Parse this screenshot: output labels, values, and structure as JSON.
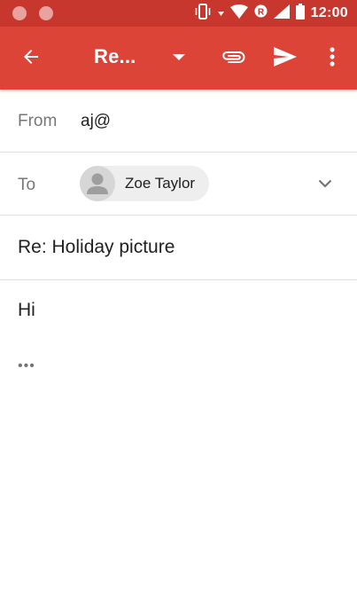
{
  "status_bar": {
    "time": "12:00",
    "colors": {
      "background": "#c8372e"
    }
  },
  "toolbar": {
    "title": "Re...",
    "back_icon": "arrow-back-icon",
    "dropdown_icon": "arrow-drop-down-icon",
    "attach_icon": "paperclip-icon",
    "send_icon": "send-icon",
    "overflow_icon": "more-vert-icon",
    "colors": {
      "background": "#db4437"
    }
  },
  "compose": {
    "from": {
      "label": "From",
      "value": "aj@"
    },
    "to": {
      "label": "To",
      "recipient_name": "Zoe Taylor",
      "expand_icon": "chevron-down-icon"
    },
    "subject": "Re: Holiday picture",
    "body": "Hi",
    "quoted_toggle": "•••"
  }
}
